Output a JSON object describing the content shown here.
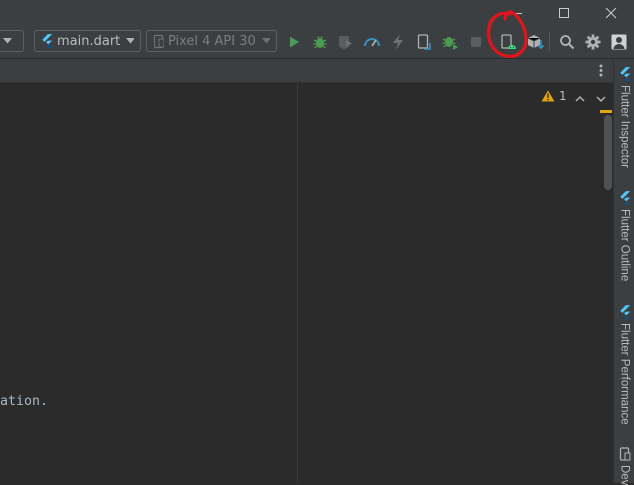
{
  "window": {
    "controls": [
      {
        "name": "minimize-button",
        "icon": "minimize-icon"
      },
      {
        "name": "maximize-button",
        "icon": "maximize-icon"
      },
      {
        "name": "close-button",
        "icon": "close-icon"
      }
    ]
  },
  "toolbar": {
    "config_selector": {
      "label": "main.dart",
      "icon": "flutter-icon"
    },
    "device_selector": {
      "label": "Pixel 4 API 30",
      "icon": "phone-icon",
      "enabled": false
    },
    "buttons": [
      {
        "name": "run-button",
        "icon": "play-icon",
        "color": "#499c54"
      },
      {
        "name": "debug-button",
        "icon": "bug-icon",
        "color": "#499c54"
      },
      {
        "name": "run-with-coverage-button",
        "icon": "coverage-icon"
      },
      {
        "name": "profile-button",
        "icon": "gauge-icon",
        "color": "#3592c4"
      },
      {
        "name": "hot-reload-button",
        "icon": "lightning-icon"
      },
      {
        "name": "hot-restart-button",
        "icon": "phone-restart-icon"
      },
      {
        "name": "attach-debugger-button",
        "icon": "attach-bug-icon",
        "color": "#499c54"
      },
      {
        "name": "stop-button",
        "icon": "stop-icon"
      },
      {
        "name": "device-manager-button",
        "icon": "device-manager-icon",
        "highlighted": true
      },
      {
        "name": "sdk-manager-button",
        "icon": "sdk-download-icon"
      },
      {
        "name": "search-everywhere-button",
        "icon": "search-icon"
      },
      {
        "name": "settings-button",
        "icon": "gear-icon"
      },
      {
        "name": "account-button",
        "icon": "user-icon"
      }
    ],
    "annotation_color": "#e0151b"
  },
  "tab_strip": {
    "more_icon": "more-vertical-icon"
  },
  "editor": {
    "visible_text": "ation.",
    "inspection": {
      "warning_count": "1",
      "warning_color": "#e5a50a"
    }
  },
  "right_panel": {
    "tabs": [
      {
        "label": "Flutter Inspector",
        "icon": "flutter-icon"
      },
      {
        "label": "Flutter Outline",
        "icon": "flutter-icon"
      },
      {
        "label": "Flutter Performance",
        "icon": "flutter-icon"
      },
      {
        "label": "Dev",
        "icon": "device-icon"
      }
    ]
  }
}
